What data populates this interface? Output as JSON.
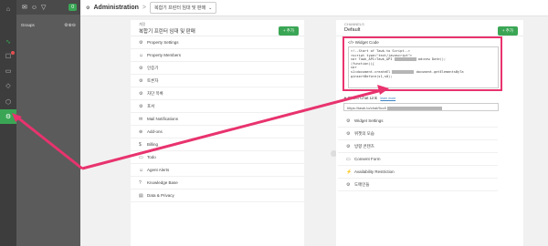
{
  "rail": {
    "items": [
      {
        "icon": "home-icon",
        "glyph": "⌂"
      },
      {
        "icon": "activity-icon",
        "glyph": "∿"
      },
      {
        "icon": "chat-icon",
        "glyph": "☐"
      },
      {
        "icon": "ticket-icon",
        "glyph": "▭"
      },
      {
        "icon": "tag-icon",
        "glyph": "◇"
      },
      {
        "icon": "box-icon",
        "glyph": "⬡"
      },
      {
        "icon": "gear-icon",
        "glyph": "⚙"
      }
    ]
  },
  "panel2": {
    "badge": "0",
    "groups_label": "Groups",
    "groups_actions": "⚙⊕⊖"
  },
  "topbar": {
    "title": "Administration",
    "separator": ">",
    "dropdown_value": "복합기 프린터 임대 및 판매"
  },
  "left": {
    "small_label": "계정",
    "name": "복합기 프린터 임대 및 판매",
    "add_label": "+ 추가",
    "items": [
      {
        "icon": "⚙",
        "label": "Property Settings"
      },
      {
        "icon": "☺",
        "label": "Property Members"
      },
      {
        "icon": "⚙",
        "label": "인증기"
      },
      {
        "icon": "⚙",
        "label": "토론자"
      },
      {
        "icon": "⚙",
        "label": "차단 목록"
      },
      {
        "icon": "⚙",
        "label": "포서"
      },
      {
        "icon": "✉",
        "label": "Mail Notifications"
      },
      {
        "icon": "⊕",
        "label": "Add-ons"
      },
      {
        "icon": "$",
        "label": "Billing"
      },
      {
        "icon": "▭",
        "label": "Todo"
      },
      {
        "icon": "☺",
        "label": "Agent Alerts"
      },
      {
        "icon": "?",
        "label": "Knowledge Base"
      },
      {
        "icon": "▤",
        "label": "Data & Privacy"
      }
    ]
  },
  "right": {
    "small_label": "CHANNELS",
    "name": "Default",
    "add_label": "+ 추가",
    "widget_title": "</> Widget Code",
    "code_lines": [
      "<!--Start of Tawk.to Script-->",
      "<script type=\"text/javascript\">",
      "var Tawk_API=Tawk_API",
      "",
      "(function(){",
      "var",
      "s1=document.createEl",
      "ginsertBefore(s1,s0);"
    ],
    "code_frag_1": "ad=new Date();",
    "code_frag_2": "document.getElementsByTa",
    "direct_chat_label": "Direct Chat Link",
    "direct_chat_link": "learn more",
    "direct_chat_url": "https://tawk.to/chat/5cc5",
    "items": [
      {
        "icon": "⚙",
        "label": "Widget Settings"
      },
      {
        "icon": "⚙",
        "label": "위젯의 모습"
      },
      {
        "icon": "⚙",
        "label": "방향 콘텐츠"
      },
      {
        "icon": "▭",
        "label": "Consent Form"
      },
      {
        "icon": "⚡",
        "label": "Availability Restriction"
      },
      {
        "icon": "⚙",
        "label": "도메인들"
      }
    ]
  },
  "colors": {
    "accent": "#3aa655",
    "highlight": "#e8336e"
  }
}
